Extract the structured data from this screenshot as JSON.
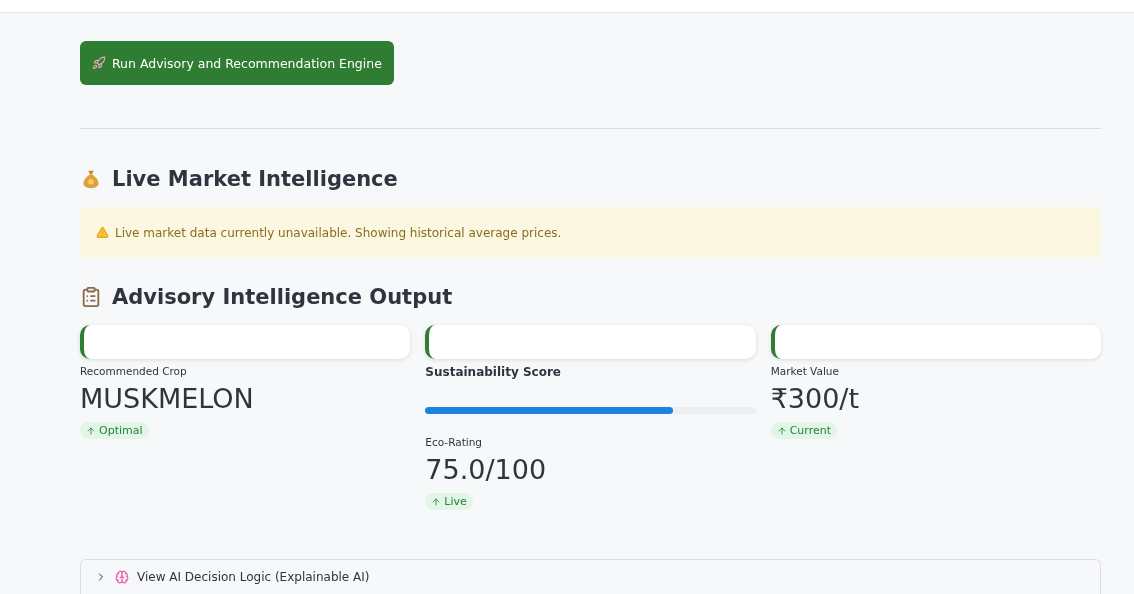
{
  "run_button": {
    "label": "Run Advisory and Recommendation Engine"
  },
  "market_section": {
    "title": "Live Market Intelligence",
    "alert": {
      "kind": "warning",
      "text": "Live market data currently unavailable. Showing historical average prices."
    }
  },
  "advisory_section": {
    "title": "Advisory Intelligence Output",
    "metrics": [
      {
        "kind": "metric",
        "label": "Recommended Crop",
        "value": "MUSKMELON",
        "delta": "Optimal"
      },
      {
        "kind": "score",
        "label": "Sustainability Score",
        "level": 0.75,
        "sub_label": "Eco-Rating",
        "value": "75.0/100",
        "delta": "Live"
      },
      {
        "kind": "metric",
        "label": "Market Value",
        "value": "₹300/t",
        "delta": "Current"
      }
    ]
  },
  "expander": {
    "label": "View AI Decision Logic (Explainable AI)",
    "expanded": false
  }
}
